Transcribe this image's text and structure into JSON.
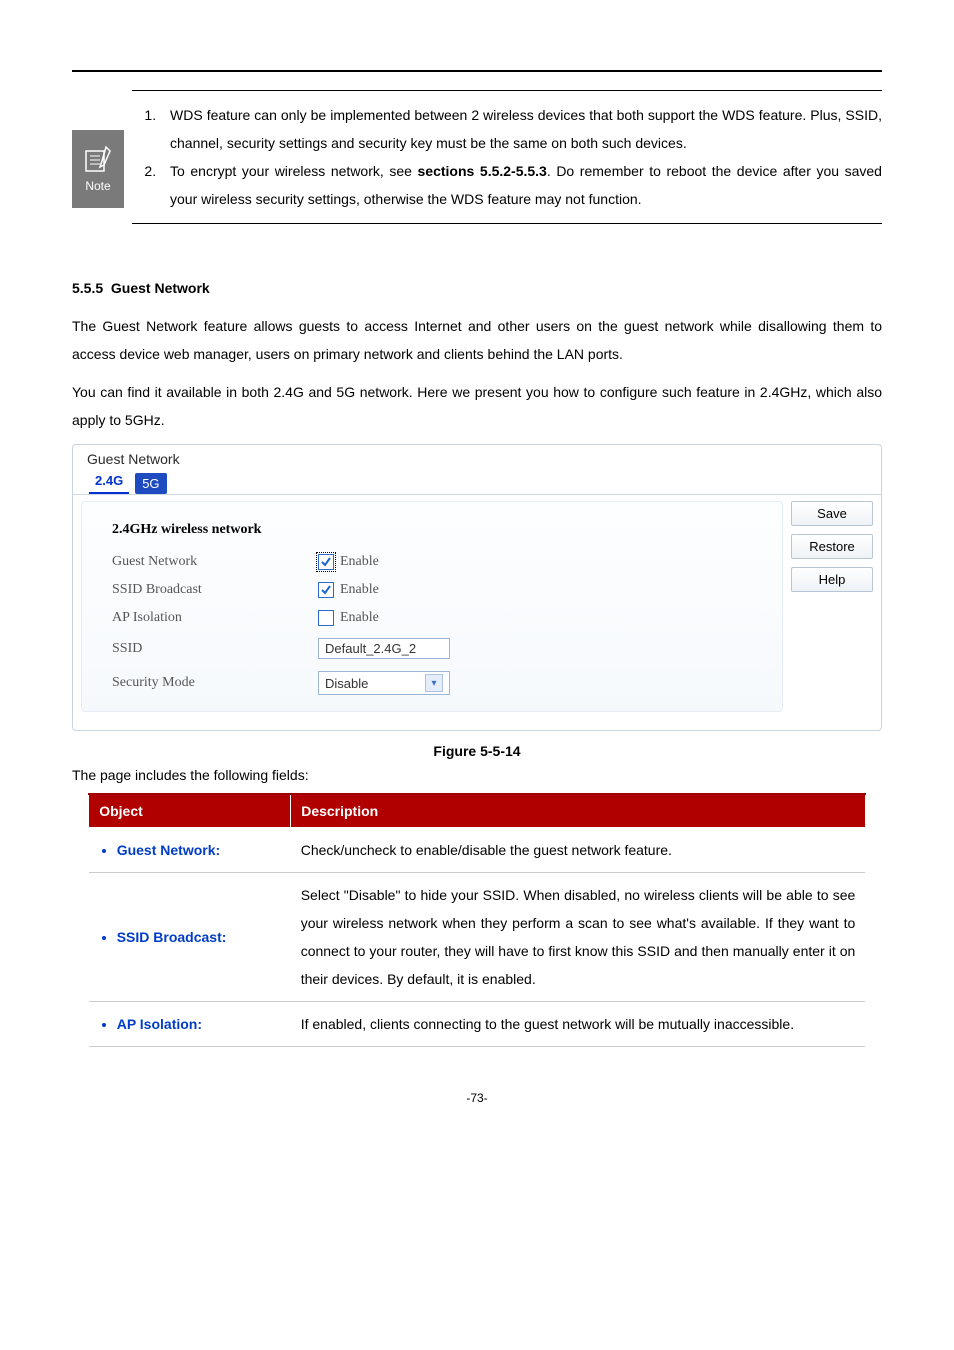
{
  "noteIconLabel": "Note",
  "notes": {
    "item1_a": "WDS feature can only be implemented between 2 wireless devices that both support the WDS feature. Plus, SSID, channel, security settings and security key must be the same on both such devices.",
    "item2_a": "To encrypt your wireless network, see ",
    "item2_bold": "sections 5.5.2-5.5.3",
    "item2_b": ". Do remember to reboot the device after you saved your wireless security settings, otherwise the WDS feature may not function."
  },
  "section": {
    "number": "5.5.5",
    "title": "Guest Network"
  },
  "paragraphs": {
    "p1": "The Guest Network feature allows guests to access Internet and other users on the guest network while disallowing them to access device web manager, users on primary network and clients behind the LAN ports.",
    "p2": "You can find it available in both 2.4G and 5G network. Here we present you how to configure such feature in 2.4GHz, which also apply to 5GHz."
  },
  "screenshot": {
    "panelTitle": "Guest Network",
    "tabs": {
      "t1": "2.4G",
      "t2": "5G"
    },
    "form": {
      "heading": "2.4GHz wireless network",
      "rows": {
        "guestNetwork": {
          "label": "Guest Network",
          "check": "Enable"
        },
        "ssidBroadcast": {
          "label": "SSID Broadcast",
          "check": "Enable"
        },
        "apIsolation": {
          "label": "AP Isolation",
          "check": "Enable"
        },
        "ssid": {
          "label": "SSID",
          "value": "Default_2.4G_2"
        },
        "securityMode": {
          "label": "Security Mode",
          "value": "Disable"
        }
      }
    },
    "buttons": {
      "save": "Save",
      "restore": "Restore",
      "help": "Help"
    }
  },
  "figureCaption": "Figure 5-5-14",
  "fieldsIntro": "The page includes the following fields:",
  "table": {
    "headers": {
      "obj": "Object",
      "desc": "Description"
    },
    "rows": {
      "r1": {
        "obj": "Guest Network:",
        "desc": "Check/uncheck to enable/disable the guest network feature."
      },
      "r2": {
        "obj": "SSID Broadcast:",
        "desc": "Select \"Disable\" to hide your SSID. When disabled, no wireless clients will be able to see your wireless network when they perform a scan to see what's available. If they want to connect to your router, they will have to first know this SSID and then manually enter it on their devices. By default, it is enabled."
      },
      "r3": {
        "obj": "AP Isolation:",
        "desc": "If enabled, clients connecting to the guest network will be mutually inaccessible."
      }
    }
  },
  "pageNumber": "-73-"
}
